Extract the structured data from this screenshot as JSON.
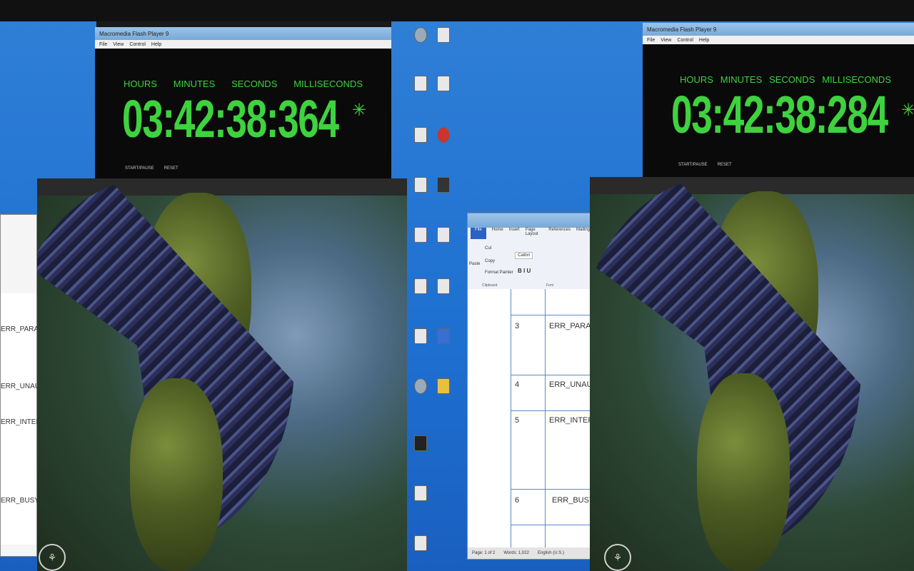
{
  "timer_left": {
    "title": "Macromedia Flash Player 9",
    "menu": [
      "File",
      "View",
      "Control",
      "Help"
    ],
    "labels": [
      "HOURS",
      "MINUTES",
      "SECONDS",
      "MILLISECONDS"
    ],
    "time": "03:42:38:364",
    "controls": [
      "START/PAUSE",
      "RESET"
    ]
  },
  "timer_right": {
    "title": "Macromedia Flash Player 9",
    "menu": [
      "File",
      "View",
      "Control",
      "Help"
    ],
    "labels": [
      "HOURS",
      "MINUTES",
      "SECONDS",
      "MILLISECONDS"
    ],
    "time": "03:42:38:284",
    "controls": [
      "START/PAUSE",
      "RESET"
    ]
  },
  "word": {
    "tabs": [
      "File",
      "Home",
      "Insert",
      "Page Layout",
      "References",
      "Mailings"
    ],
    "font_name": "Calibri",
    "clipboard": [
      "Cut",
      "Copy",
      "Format Painter"
    ],
    "paste_label": "Paste",
    "groups": [
      "Clipboard",
      "Font"
    ],
    "rows": [
      {
        "num": "3",
        "code": "ERR_PARAME"
      },
      {
        "num": "4",
        "code": "ERR_UNAUTH"
      },
      {
        "num": "5",
        "code": "ERR_INTERNA"
      },
      {
        "num": "6",
        "code": "ERR_BUSY_P"
      }
    ],
    "left_rows": [
      "ERR_PARAME",
      "ERR_UNAUTH",
      "ERR_INTERNA",
      "ERR_BUSY_PI"
    ],
    "status": [
      "Page: 1 of 2",
      "Words: 1,022",
      "English (U.S.)"
    ]
  },
  "accent": "#3fd23f"
}
